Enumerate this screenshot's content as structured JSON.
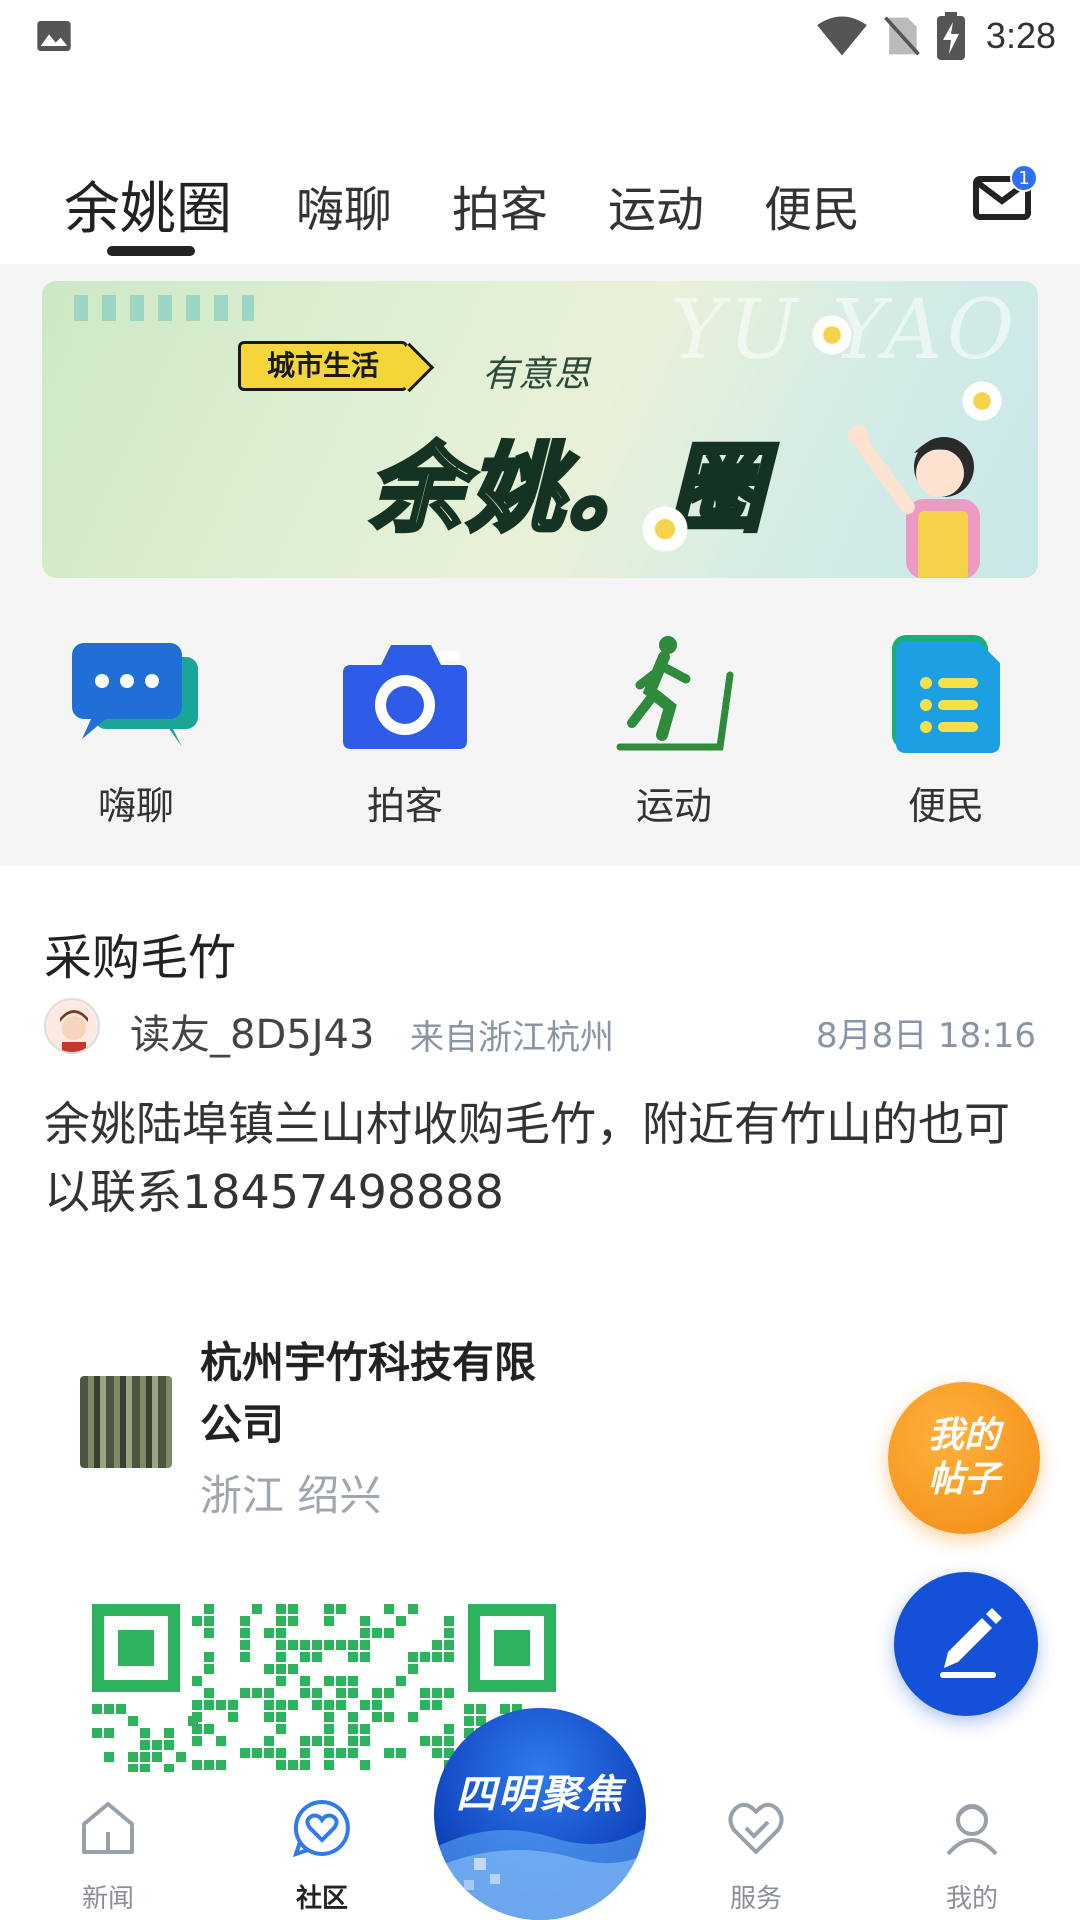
{
  "status_bar": {
    "time": "3:28"
  },
  "top_tabs": [
    {
      "label": "余姚圈",
      "active": true
    },
    {
      "label": "嗨聊",
      "active": false
    },
    {
      "label": "拍客",
      "active": false
    },
    {
      "label": "运动",
      "active": false
    },
    {
      "label": "便民",
      "active": false
    }
  ],
  "mail": {
    "badge": "1"
  },
  "banner": {
    "watermark": "YU YAO",
    "tag": "城市生活",
    "subtitle": "有意思",
    "headline": "余姚。圈"
  },
  "quick_entries": [
    {
      "label": "嗨聊",
      "icon": "chat-bubbles-icon"
    },
    {
      "label": "拍客",
      "icon": "camera-icon"
    },
    {
      "label": "运动",
      "icon": "treadmill-runner-icon"
    },
    {
      "label": "便民",
      "icon": "document-list-icon"
    }
  ],
  "post": {
    "title": "采购毛竹",
    "username": "读友_8D5J43",
    "location": "来自浙江杭州",
    "time": "8月8日 18:16",
    "body": "余姚陆埠镇兰山村收购毛竹，附近有竹山的也可以联系18457498888",
    "company": {
      "name": "杭州宇竹科技有限公司",
      "location": "浙江 绍兴"
    }
  },
  "fab": {
    "my_posts": "我的帖子"
  },
  "bottom_nav": [
    {
      "label": "新闻",
      "icon": "home-icon",
      "active": false
    },
    {
      "label": "社区",
      "icon": "heart-chat-icon",
      "active": true
    },
    {
      "label": "服务",
      "icon": "heart-icon",
      "active": false
    },
    {
      "label": "我的",
      "icon": "person-icon",
      "active": false
    }
  ],
  "center_logo": {
    "text": "四明聚焦"
  },
  "colors": {
    "accent": "#1450d8",
    "fab_orange": "#f28a12",
    "qr_green": "#2db35d",
    "active_nav": "#2f7af0"
  }
}
